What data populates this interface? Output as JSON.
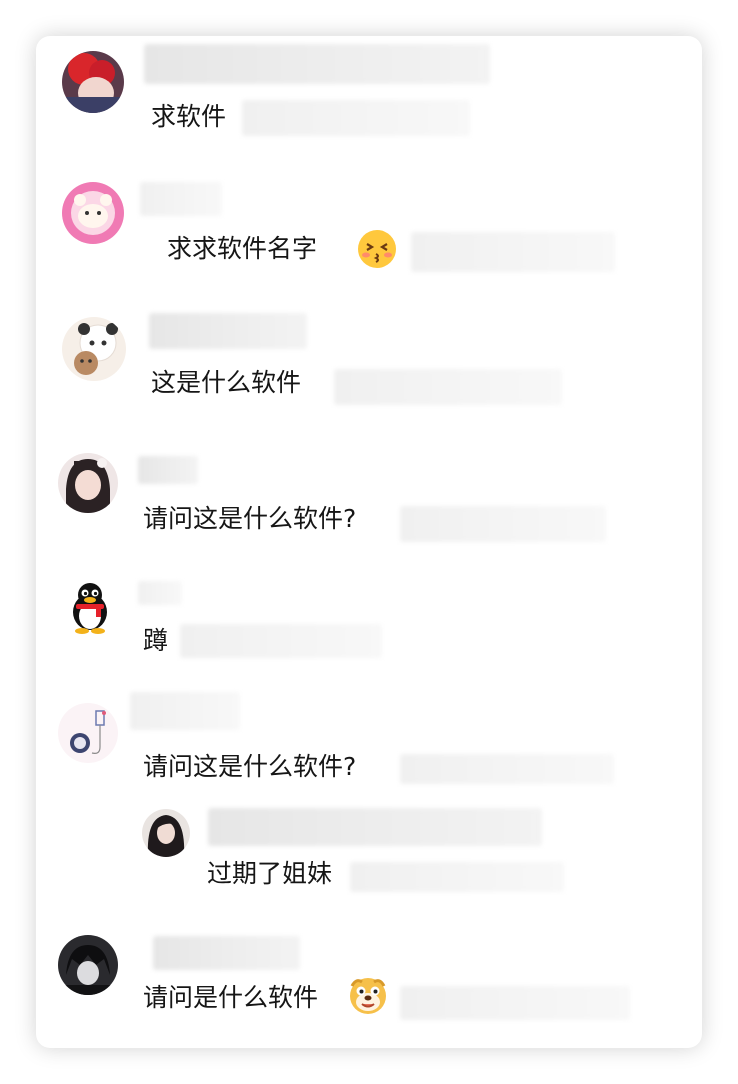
{
  "comments": [
    {
      "text": "求软件",
      "avatar_icon": "red-haired-anime-avatar"
    },
    {
      "text": "求求软件名字",
      "avatar_icon": "pink-bear-avatar",
      "emoji": "kissing-face-emoji"
    },
    {
      "text": "这是什么软件",
      "avatar_icon": "panda-bear-avatar"
    },
    {
      "text": "请问这是什么软件?",
      "avatar_icon": "girl-portrait-avatar"
    },
    {
      "text": "蹲",
      "avatar_icon": "qq-penguin-avatar"
    },
    {
      "text": "请问这是什么软件?",
      "avatar_icon": "doodle-avatar",
      "reply": {
        "text": "过期了姐妹",
        "avatar_icon": "dark-hair-girl-avatar"
      }
    },
    {
      "text": "请问是什么软件",
      "avatar_icon": "dark-anime-avatar",
      "emoji": "dog-face-emoji"
    }
  ],
  "colors": {
    "text": "#161616",
    "redacted": "#e8e8e8"
  }
}
